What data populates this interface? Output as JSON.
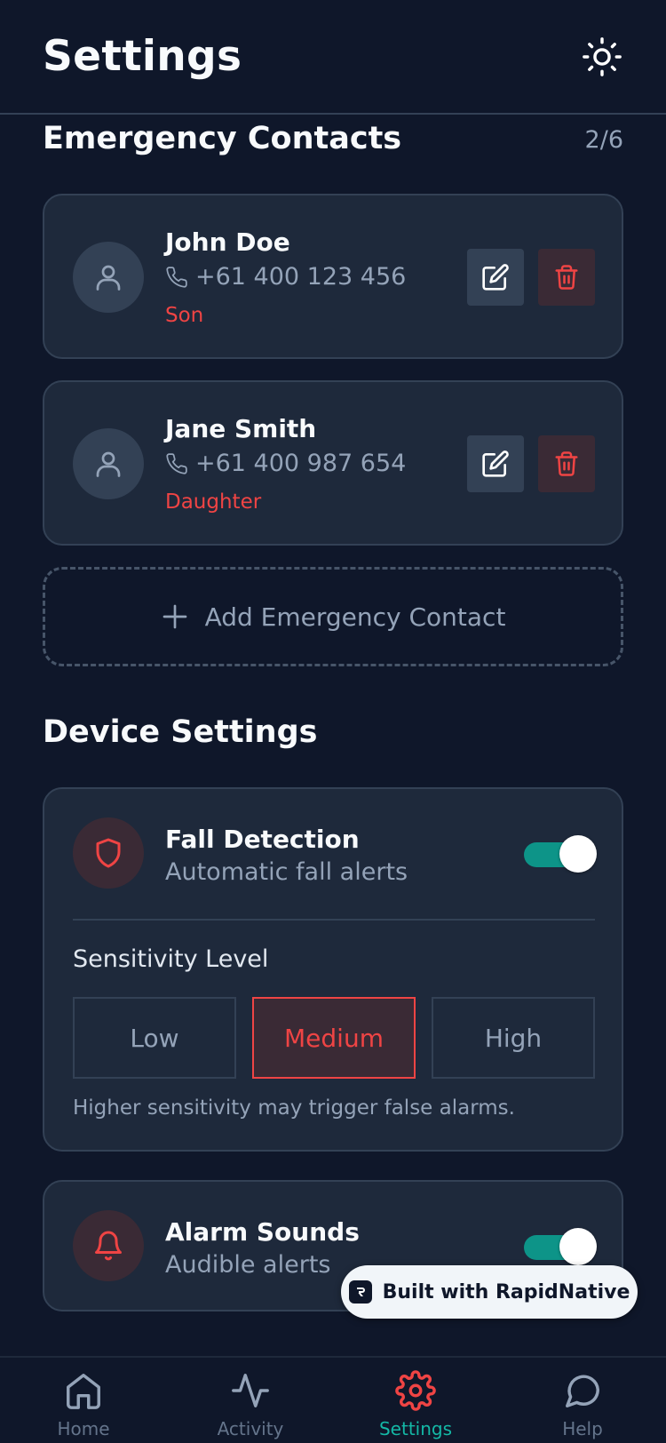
{
  "header": {
    "title": "Settings",
    "theme_icon": "sun-icon"
  },
  "emergency": {
    "title": "Emergency Contacts",
    "count": "2/6",
    "contacts": [
      {
        "name": "John Doe",
        "phone": "+61 400 123 456",
        "relation": "Son"
      },
      {
        "name": "Jane Smith",
        "phone": "+61 400 987 654",
        "relation": "Daughter"
      }
    ],
    "add_label": "Add Emergency Contact"
  },
  "device": {
    "title": "Device Settings",
    "fall": {
      "title": "Fall Detection",
      "subtitle": "Automatic fall alerts",
      "enabled": true,
      "sensitivity_label": "Sensitivity Level",
      "options": [
        "Low",
        "Medium",
        "High"
      ],
      "selected": "Medium",
      "note": "Higher sensitivity may trigger false alarms."
    },
    "alarm": {
      "title": "Alarm Sounds",
      "subtitle": "Audible alerts",
      "enabled": true
    }
  },
  "badge": {
    "label": "Built with RapidNative"
  },
  "nav": {
    "items": [
      {
        "label": "Home",
        "icon": "home-icon"
      },
      {
        "label": "Activity",
        "icon": "activity-icon"
      },
      {
        "label": "Settings",
        "icon": "gear-icon"
      },
      {
        "label": "Help",
        "icon": "chat-bubble-icon"
      }
    ],
    "active": "Settings"
  },
  "colors": {
    "background": "#0f172a",
    "card": "#1e293b",
    "accent_red": "#ef4444",
    "accent_teal": "#0d9488",
    "active_nav": "#14b8a6"
  }
}
